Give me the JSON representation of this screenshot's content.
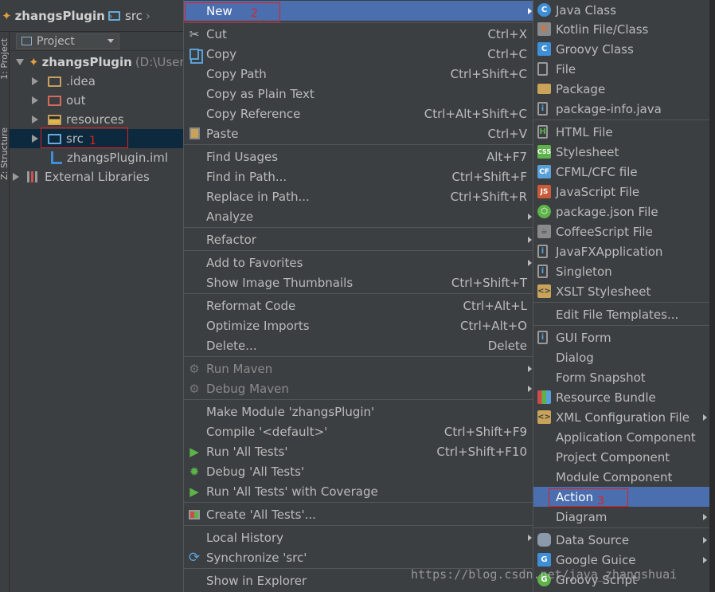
{
  "nav": {
    "project": "zhangsPlugin",
    "folder": "src"
  },
  "stripe": {
    "project_label": "1: Project",
    "structure_label": "Z: Structure"
  },
  "panel": {
    "title": "Project"
  },
  "tree": {
    "root": "zhangsPlugin",
    "root_path": "(D:\\Users",
    "items": [
      "idea",
      "out",
      "resources",
      "src",
      "zhangsPlugin.iml",
      "External Libraries"
    ]
  },
  "annotations": {
    "one": "1",
    "two": "2",
    "three": "3"
  },
  "menu": {
    "items": [
      {
        "label": "New",
        "shortcut": ""
      },
      {
        "label": "Cut",
        "shortcut": "Ctrl+X"
      },
      {
        "label": "Copy",
        "shortcut": "Ctrl+C"
      },
      {
        "label": "Copy Path",
        "shortcut": "Ctrl+Shift+C"
      },
      {
        "label": "Copy as Plain Text",
        "shortcut": ""
      },
      {
        "label": "Copy Reference",
        "shortcut": "Ctrl+Alt+Shift+C"
      },
      {
        "label": "Paste",
        "shortcut": "Ctrl+V"
      },
      {
        "label": "Find Usages",
        "shortcut": "Alt+F7"
      },
      {
        "label": "Find in Path...",
        "shortcut": "Ctrl+Shift+F"
      },
      {
        "label": "Replace in Path...",
        "shortcut": "Ctrl+Shift+R"
      },
      {
        "label": "Analyze",
        "shortcut": ""
      },
      {
        "label": "Refactor",
        "shortcut": ""
      },
      {
        "label": "Add to Favorites",
        "shortcut": ""
      },
      {
        "label": "Show Image Thumbnails",
        "shortcut": "Ctrl+Shift+T"
      },
      {
        "label": "Reformat Code",
        "shortcut": "Ctrl+Alt+L"
      },
      {
        "label": "Optimize Imports",
        "shortcut": "Ctrl+Alt+O"
      },
      {
        "label": "Delete...",
        "shortcut": "Delete"
      },
      {
        "label": "Run Maven",
        "shortcut": ""
      },
      {
        "label": "Debug Maven",
        "shortcut": ""
      },
      {
        "label": "Make Module 'zhangsPlugin'",
        "shortcut": ""
      },
      {
        "label": "Compile '<default>'",
        "shortcut": "Ctrl+Shift+F9"
      },
      {
        "label": "Run 'All Tests'",
        "shortcut": "Ctrl+Shift+F10"
      },
      {
        "label": "Debug 'All Tests'",
        "shortcut": ""
      },
      {
        "label": "Run 'All Tests' with Coverage",
        "shortcut": ""
      },
      {
        "label": "Create 'All Tests'...",
        "shortcut": ""
      },
      {
        "label": "Local History",
        "shortcut": ""
      },
      {
        "label": "Synchronize 'src'",
        "shortcut": ""
      },
      {
        "label": "Show in Explorer",
        "shortcut": ""
      }
    ]
  },
  "submenu": {
    "items": [
      "Java Class",
      "Kotlin File/Class",
      "Groovy Class",
      "File",
      "Package",
      "package-info.java",
      "HTML File",
      "Stylesheet",
      "CFML/CFC file",
      "JavaScript File",
      "package.json File",
      "CoffeeScript File",
      "JavaFXApplication",
      "Singleton",
      "XSLT Stylesheet",
      "Edit File Templates...",
      "GUI Form",
      "Dialog",
      "Form Snapshot",
      "Resource Bundle",
      "XML Configuration File",
      "Application Component",
      "Project Component",
      "Module Component",
      "Action",
      "Diagram",
      "Data Source",
      "Google Guice",
      "Groovy Script"
    ]
  },
  "watermark": "https://blog.csdn.net/java_zhangshuai"
}
